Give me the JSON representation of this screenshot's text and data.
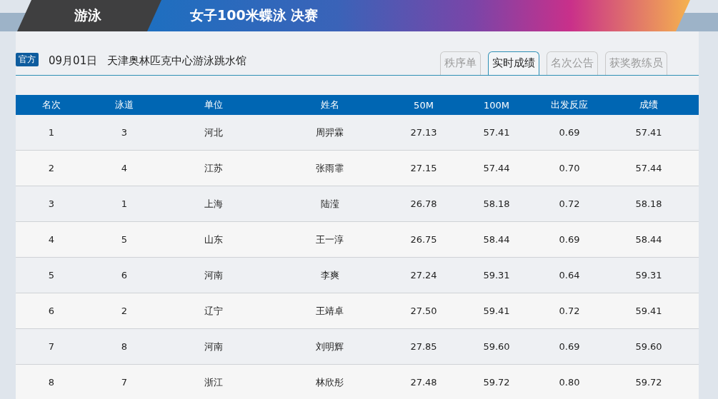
{
  "header": {
    "sport": "游泳",
    "event": "女子100米蝶泳 决赛"
  },
  "info": {
    "badge": "官方",
    "date": "09月01日",
    "venue": "天津奥林匹克中心游泳跳水馆"
  },
  "tabs": [
    {
      "label": "秩序单",
      "selected": false
    },
    {
      "label": "实时成绩",
      "selected": true
    },
    {
      "label": "名次公告",
      "selected": false
    },
    {
      "label": "获奖教练员",
      "selected": false
    }
  ],
  "table": {
    "columns": [
      "名次",
      "泳道",
      "单位",
      "姓名",
      "50M",
      "100M",
      "出发反应",
      "成绩"
    ],
    "rows": [
      [
        "1",
        "3",
        "河北",
        "周羿霖",
        "27.13",
        "57.41",
        "0.69",
        "57.41"
      ],
      [
        "2",
        "4",
        "江苏",
        "张雨霏",
        "27.15",
        "57.44",
        "0.70",
        "57.44"
      ],
      [
        "3",
        "1",
        "上海",
        "陆滢",
        "26.78",
        "58.18",
        "0.72",
        "58.18"
      ],
      [
        "4",
        "5",
        "山东",
        "王一淳",
        "26.75",
        "58.44",
        "0.69",
        "58.44"
      ],
      [
        "5",
        "6",
        "河南",
        "李爽",
        "27.24",
        "59.31",
        "0.64",
        "59.31"
      ],
      [
        "6",
        "2",
        "辽宁",
        "王靖卓",
        "27.50",
        "59.41",
        "0.72",
        "59.41"
      ],
      [
        "7",
        "8",
        "河南",
        "刘明辉",
        "27.85",
        "59.60",
        "0.69",
        "59.60"
      ],
      [
        "8",
        "7",
        "浙江",
        "林欣彤",
        "27.48",
        "59.72",
        "0.80",
        "59.72"
      ]
    ]
  }
}
